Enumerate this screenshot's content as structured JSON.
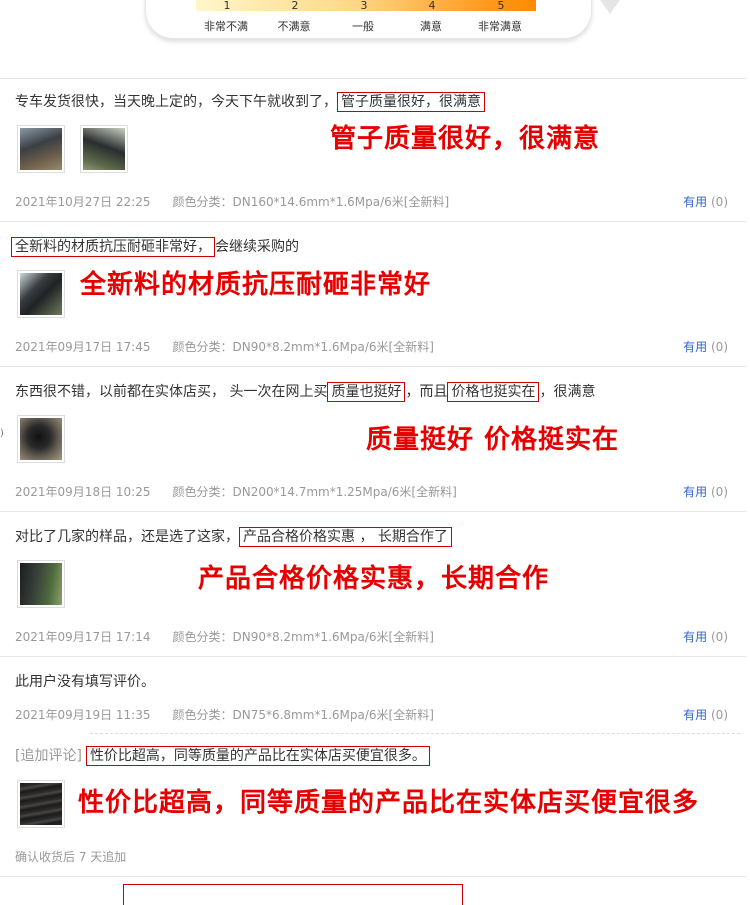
{
  "rating_scale": {
    "numbers": [
      "1",
      "2",
      "3",
      "4",
      "5"
    ],
    "labels": [
      "非常不满",
      "不满意",
      "一般",
      "满意",
      "非常满意"
    ]
  },
  "reviews": [
    {
      "text_before": "专车发货很快，当天晚上定的，今天下午就收到了，",
      "highlight": "管子质量很好，很满意",
      "callout": "管子质量很好，很满意",
      "date": "2021年10月27日 22:25",
      "sku": "颜色分类：DN160*14.6mm*1.6Mpa/6米[全新料]",
      "useful_label": "有用",
      "useful_count": "(0)"
    },
    {
      "highlight": "全新料的材质抗压耐砸非常好，",
      "text_after": "会继续采购的",
      "callout": "全新料的材质抗压耐砸非常好",
      "date": "2021年09月17日 17:45",
      "sku": "颜色分类：DN90*8.2mm*1.6Mpa/6米[全新料]",
      "useful_label": "有用",
      "useful_count": "(0)"
    },
    {
      "text_before": "东西很不错，以前都在实体店买， 头一次在网上买",
      "highlight": "质量也挺好",
      "text_mid": "，而且",
      "highlight2": "价格也挺实在",
      "text_after": "，很满意",
      "callout": "质量挺好 价格挺实在",
      "date": "2021年09月18日 10:25",
      "sku": "颜色分类：DN200*14.7mm*1.25Mpa/6米[全新料]",
      "useful_label": "有用",
      "useful_count": "(0)"
    },
    {
      "text_before": "对比了几家的样品，还是选了这家，",
      "highlight": "产品合格价格实惠 ， 长期合作了",
      "callout": "产品合格价格实惠，长期合作",
      "date": "2021年09月17日 17:14",
      "sku": "颜色分类：DN90*8.2mm*1.6Mpa/6米[全新料]",
      "useful_label": "有用",
      "useful_count": "(0)"
    },
    {
      "text": "此用户没有填写评价。",
      "date": "2021年09月19日 11:35",
      "sku": "颜色分类：DN75*6.8mm*1.6Mpa/6米[全新料]",
      "useful_label": "有用",
      "useful_count": "(0)",
      "append_prefix": "[追加评论]",
      "append_text": "性价比超高，同等质量的产品比在实体店买便宜很多。",
      "callout": "性价比超高，同等质量的产品比在实体店买便宜很多",
      "append_note": "确认收货后 7 天追加"
    }
  ]
}
